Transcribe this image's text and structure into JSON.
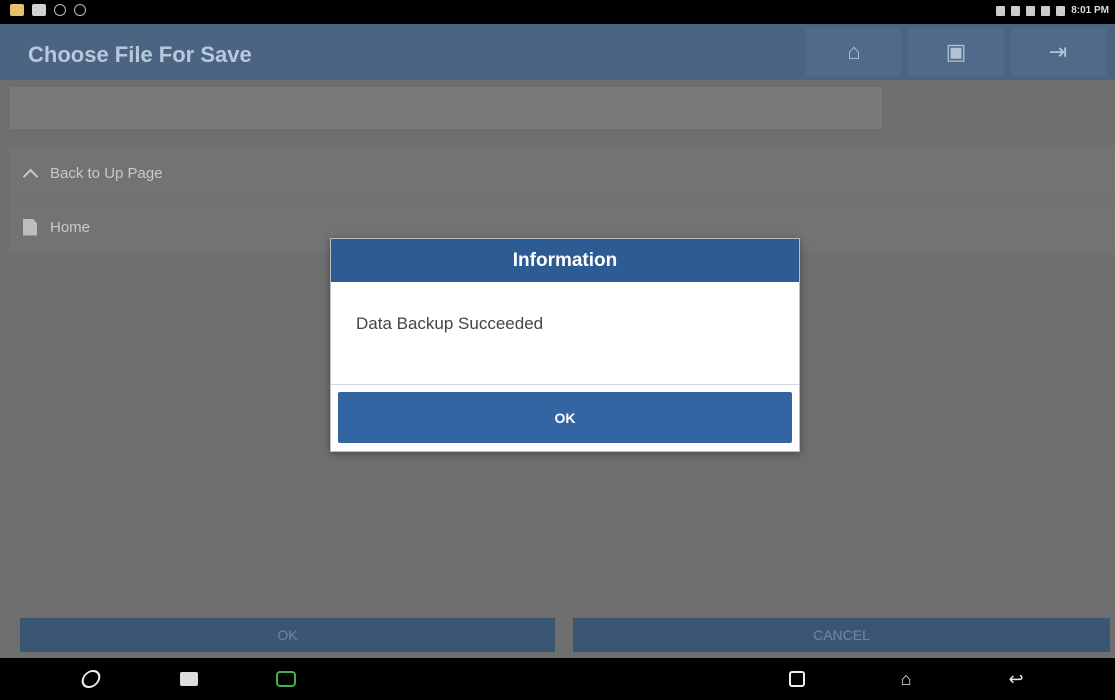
{
  "status_bar": {
    "time": "8:01 PM",
    "left_icons": [
      "app-notification-icon",
      "image-icon",
      "wifi-outline-icon",
      "settings-circle-icon"
    ],
    "right_icons": [
      "bluetooth-icon",
      "location-icon",
      "wifi-icon",
      "signal-icon",
      "battery-icon"
    ]
  },
  "header": {
    "title": "Choose File For Save",
    "buttons": [
      {
        "name": "home-icon",
        "glyph": "⌂"
      },
      {
        "name": "print-icon",
        "glyph": "▣"
      },
      {
        "name": "exit-icon",
        "glyph": "⇥"
      }
    ]
  },
  "file_list": {
    "path_value": "",
    "back_label": "Back to Up Page",
    "items": [
      {
        "label": "Home"
      }
    ]
  },
  "bottom_buttons": {
    "ok_label": "OK",
    "cancel_label": "CANCEL"
  },
  "dialog": {
    "title": "Information",
    "message": "Data Backup Succeeded",
    "ok_label": "OK"
  },
  "nav_bar": {
    "icons": [
      "browser-icon",
      "gallery-icon",
      "car-diagnostic-icon",
      "recent-apps-icon",
      "home-nav-icon",
      "back-nav-icon"
    ]
  },
  "colors": {
    "header": "#4a6482",
    "dialog_header": "#2d5b94",
    "dialog_button": "#3465a3",
    "overlay_content": "#6f6f6f"
  }
}
